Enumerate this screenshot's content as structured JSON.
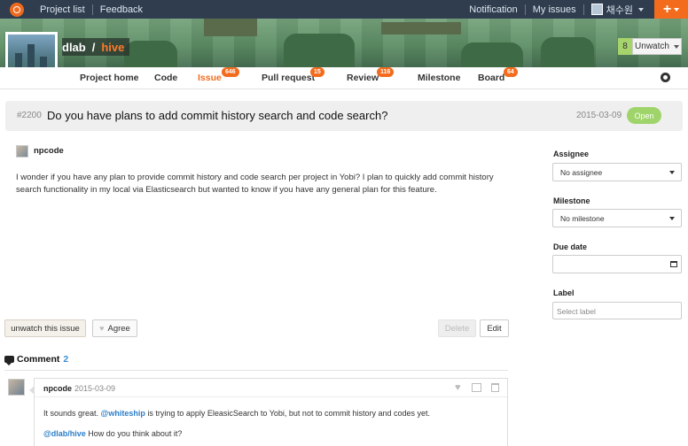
{
  "topbar": {
    "left_links": [
      "Project list",
      "Feedback"
    ],
    "right_links": [
      "Notification",
      "My issues"
    ],
    "user_name": "채수원",
    "new_label": "+"
  },
  "project": {
    "owner": "dlab",
    "separator": "/",
    "name": "hive",
    "watch_count": "8",
    "watch_label": "Unwatch"
  },
  "tabs": [
    {
      "label": "Project home",
      "badge": ""
    },
    {
      "label": "Code",
      "badge": ""
    },
    {
      "label": "Issue",
      "badge": "646"
    },
    {
      "label": "Pull request",
      "badge": "15"
    },
    {
      "label": "Review",
      "badge": "116"
    },
    {
      "label": "Milestone",
      "badge": ""
    },
    {
      "label": "Board",
      "badge": "64"
    }
  ],
  "issue": {
    "number": "#2200",
    "title": "Do you have plans to add commit history search and code search?",
    "date": "2015-03-09",
    "state": "Open",
    "author": "npcode",
    "body": "I wonder if you have any plan to provide commit history and code search per project in Yobi? I plan to quickly add commit history search functionality in my local via Elasticsearch but wanted to know if you have any general plan for this feature."
  },
  "sidebar": {
    "assignee_label": "Assignee",
    "assignee_value": "No assignee",
    "milestone_label": "Milestone",
    "milestone_value": "No milestone",
    "due_label": "Due date",
    "due_value": "",
    "label_label": "Label",
    "label_placeholder": "Select label"
  },
  "actions": {
    "unwatch": "unwatch this issue",
    "agree": "Agree",
    "delete": "Delete",
    "edit": "Edit"
  },
  "comments": {
    "heading": "Comment",
    "count": "2",
    "items": [
      {
        "author": "npcode",
        "date": "2015-03-09",
        "line1_pre": "It sounds great. ",
        "line1_mention": "@whiteship",
        "line1_post": " is trying to apply EleasicSearch to Yobi, but not to commit history and codes yet.",
        "line2_mention": "@dlab/hive",
        "line2_post": " How do you think about it?"
      }
    ]
  },
  "colors": {
    "accent": "#f36c1e",
    "topbar": "#2f3d4f",
    "open_badge": "#9ed46a",
    "mention": "#2d7fc9"
  }
}
